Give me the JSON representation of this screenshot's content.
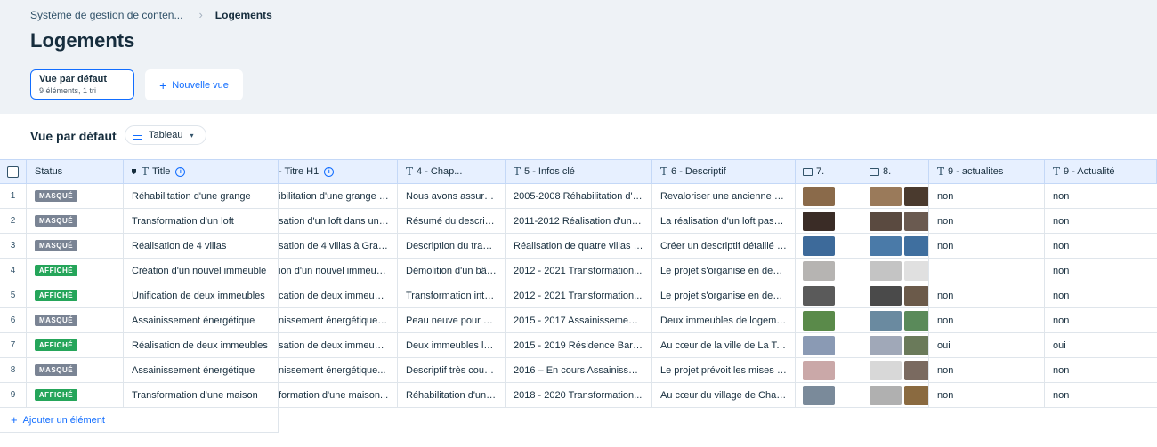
{
  "breadcrumb": {
    "parent": "Système de gestion de conten...",
    "current": "Logements"
  },
  "page_title": "Logements",
  "views": {
    "default_name": "Vue par défaut",
    "default_meta": "9 éléments, 1 tri",
    "new_view_label": "Nouvelle vue"
  },
  "toolbar": {
    "view_title": "Vue par défaut",
    "layout_label": "Tableau"
  },
  "columns": {
    "status": "Status",
    "title": "Title",
    "titre_h1": "- Titre H1",
    "chap": "4 - Chap...",
    "infos": "5 - Infos clé",
    "desc": "6 - Descriptif",
    "img7": "7.",
    "img8": "8.",
    "act1": "9 - actualites",
    "act2": "9 - Actualité"
  },
  "rows": [
    {
      "idx": "1",
      "status": "MASQUÉ",
      "title": "Réhabilitation d'une grange",
      "h1": "ibilitation d'une grange en...",
      "chap": "Nous avons assuré...",
      "infos": "2005-2008 Réhabilitation d'une...",
      "desc": "Revaloriser une ancienne grange...",
      "act1": "non",
      "act2": "non"
    },
    {
      "idx": "2",
      "status": "MASQUÉ",
      "title": "Transformation d'un loft",
      "h1": "sation d'un loft dans un ancien...",
      "chap": "Résumé du descriptif...",
      "infos": "2011-2012 Réalisation d'un loft...",
      "desc": "La réalisation d'un loft passe...",
      "act1": "non",
      "act2": "non"
    },
    {
      "idx": "3",
      "status": "MASQUÉ",
      "title": "Réalisation de 4 villas",
      "h1": "sation de 4 villas à Granges...",
      "chap": "Description du travail...",
      "infos": "Réalisation de quatre villas à...",
      "desc": "Créer un descriptif détaillé pour...",
      "act1": "non",
      "act2": "non"
    },
    {
      "idx": "4",
      "status": "AFFICHÉ",
      "title": "Création d'un nouvel immeuble",
      "h1": "ion d'un nouvel immeuble...",
      "chap": "Démolition d'un bâtiment...",
      "infos": "2012 - 2021 Transformation...",
      "desc": "Le projet s'organise en deux...",
      "act1": "",
      "act2": "non"
    },
    {
      "idx": "5",
      "status": "AFFICHÉ",
      "title": "Unification de deux immeubles",
      "h1": "cation de deux immeubles...",
      "chap": "Transformation intérieure...",
      "infos": "2012 - 2021 Transformation...",
      "desc": "Le projet s'organise en deux...",
      "act1": "non",
      "act2": "non"
    },
    {
      "idx": "6",
      "status": "MASQUÉ",
      "title": "Assainissement énergétique",
      "h1": "nissement énergétique d'un...",
      "chap": "Peau neuve pour deux...",
      "infos": "2015 - 2017 Assainissement...",
      "desc": "Deux immeubles de logements...",
      "act1": "non",
      "act2": "non"
    },
    {
      "idx": "7",
      "status": "AFFICHÉ",
      "title": "Réalisation de deux immeubles",
      "h1": "sation de deux immeubles...",
      "chap": "Deux immeubles locatifs...",
      "infos": "2015 - 2019 Résidence Barnabé...",
      "desc": "Au cœur de la ville de La Tour...",
      "act1": "oui",
      "act2": "oui"
    },
    {
      "idx": "8",
      "status": "MASQUÉ",
      "title": "Assainissement énergétique",
      "h1": "nissement énergétique...",
      "chap": "Descriptif très court...",
      "infos": "2016 – En cours Assainissement...",
      "desc": "Le projet prévoit les mises aux...",
      "act1": "non",
      "act2": "non"
    },
    {
      "idx": "9",
      "status": "AFFICHÉ",
      "title": "Transformation d'une maison",
      "h1": "formation d'une maison...",
      "chap": "Réhabilitation d'une...",
      "infos": "2018 - 2020 Transformation...",
      "desc": "Au cœur du village de Champéry...",
      "act1": "non",
      "act2": "non"
    }
  ],
  "add_item_label": "Ajouter un élément",
  "colors": {
    "accent": "#116dff",
    "badge_hidden": "#7a8494",
    "badge_shown": "#25a55a",
    "header_bg": "#e7f0ff"
  },
  "thumbnails": [
    {
      "img7": [
        "#8a6a4a"
      ],
      "img8": [
        "#9a7a5a",
        "#4a3a2e"
      ]
    },
    {
      "img7": [
        "#3a2c26"
      ],
      "img8": [
        "#5a4a40",
        "#6a5a50"
      ]
    },
    {
      "img7": [
        "#3d6a9a"
      ],
      "img8": [
        "#4a7aa8",
        "#3f6f9f"
      ]
    },
    {
      "img7": [
        "#b6b4b2"
      ],
      "img8": [
        "#c4c4c4",
        "#e0e0e0"
      ]
    },
    {
      "img7": [
        "#5a5a5a"
      ],
      "img8": [
        "#4a4a4a",
        "#6b5a4a"
      ]
    },
    {
      "img7": [
        "#5a8a4a"
      ],
      "img8": [
        "#6a8aa0",
        "#5a8a5a"
      ]
    },
    {
      "img7": [
        "#8a9ab4"
      ],
      "img8": [
        "#a0a8b8",
        "#6a7a5a"
      ]
    },
    {
      "img7": [
        "#caa8a8"
      ],
      "img8": [
        "#d8d8d8",
        "#7a6a60"
      ]
    },
    {
      "img7": [
        "#7a8a9a"
      ],
      "img8": [
        "#b0b0b0",
        "#8a6a40"
      ]
    }
  ]
}
